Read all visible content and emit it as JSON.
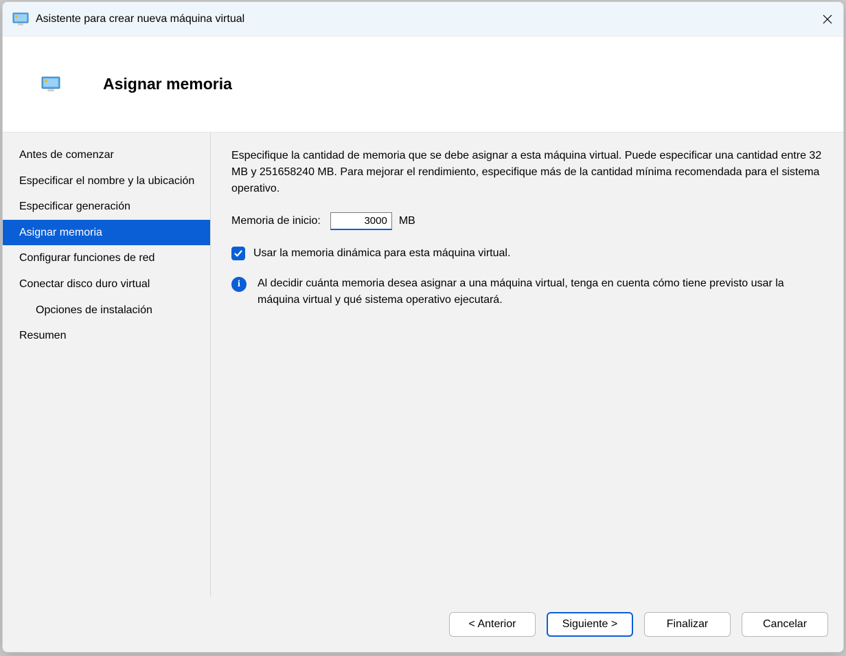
{
  "window": {
    "title": "Asistente para crear nueva máquina virtual"
  },
  "header": {
    "title": "Asignar memoria"
  },
  "sidebar": {
    "items": [
      {
        "label": "Antes de comenzar",
        "indent": false,
        "active": false
      },
      {
        "label": "Especificar el nombre y la ubicación",
        "indent": false,
        "active": false
      },
      {
        "label": "Especificar generación",
        "indent": false,
        "active": false
      },
      {
        "label": "Asignar memoria",
        "indent": false,
        "active": true
      },
      {
        "label": "Configurar funciones de red",
        "indent": false,
        "active": false
      },
      {
        "label": "Conectar disco duro virtual",
        "indent": false,
        "active": false
      },
      {
        "label": "Opciones de instalación",
        "indent": true,
        "active": false
      },
      {
        "label": "Resumen",
        "indent": false,
        "active": false
      }
    ]
  },
  "content": {
    "description": "Especifique la cantidad de memoria que se debe asignar a esta máquina virtual. Puede especificar una cantidad entre 32 MB y 251658240 MB. Para mejorar el rendimiento, especifique más de la cantidad mínima recomendada para el sistema operativo.",
    "memory_label": "Memoria de inicio:",
    "memory_value": "3000",
    "memory_unit": "MB",
    "dynamic_checked": true,
    "dynamic_label": "Usar la memoria dinámica para esta máquina virtual.",
    "info_text": "Al decidir cuánta memoria desea asignar a una máquina virtual, tenga en cuenta cómo tiene previsto usar la máquina virtual y qué sistema operativo ejecutará."
  },
  "footer": {
    "previous": "< Anterior",
    "next": "Siguiente >",
    "finish": "Finalizar",
    "cancel": "Cancelar"
  }
}
